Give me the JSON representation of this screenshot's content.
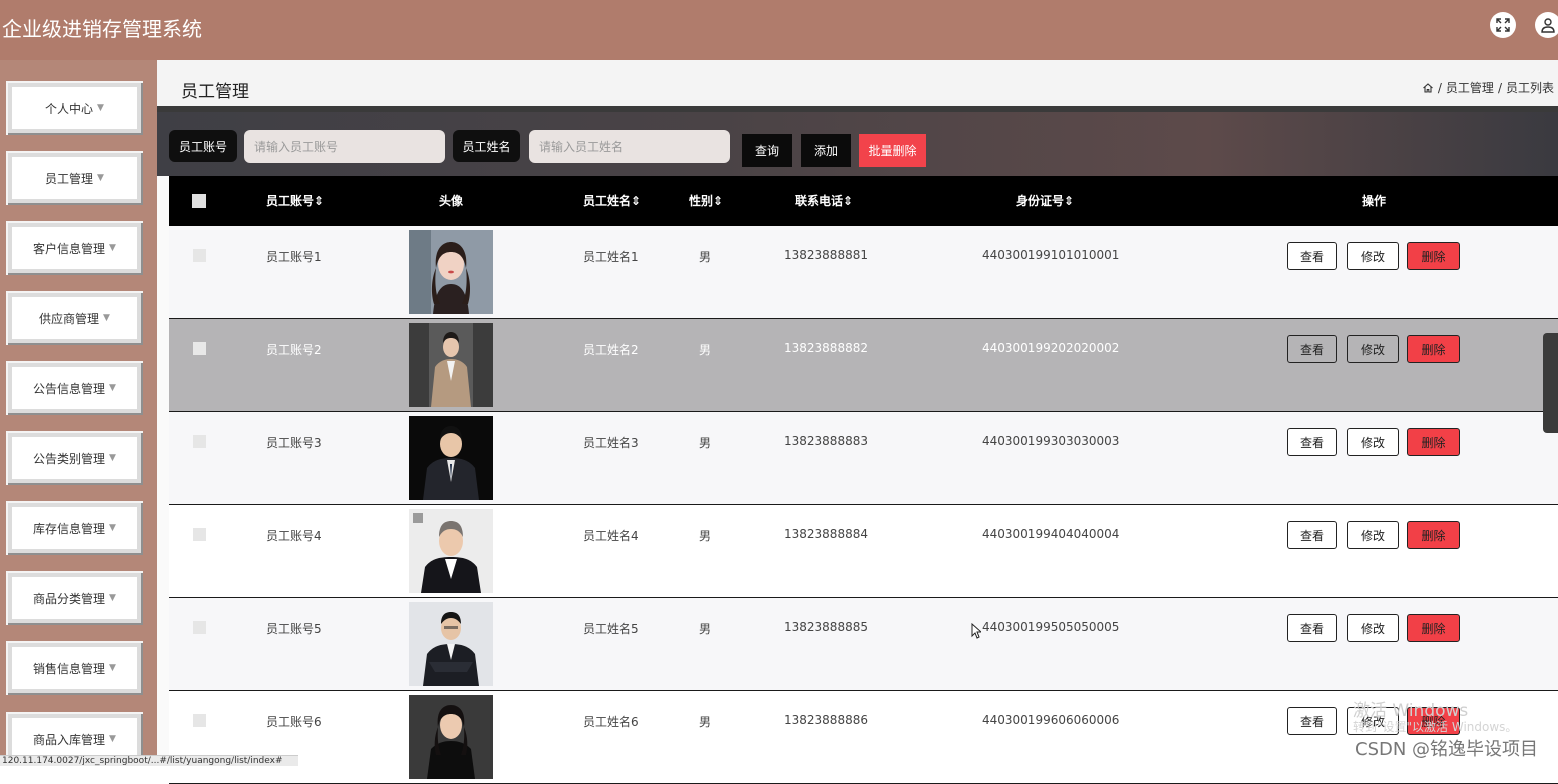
{
  "app": {
    "title": "企业级进销存管理系统",
    "top_icons": [
      "fullscreen-icon",
      "user-icon"
    ]
  },
  "sidebar": {
    "items": [
      {
        "label": "个人中心"
      },
      {
        "label": "员工管理"
      },
      {
        "label": "客户信息管理"
      },
      {
        "label": "供应商管理"
      },
      {
        "label": "公告信息管理"
      },
      {
        "label": "公告类别管理"
      },
      {
        "label": "库存信息管理"
      },
      {
        "label": "商品分类管理"
      },
      {
        "label": "销售信息管理"
      },
      {
        "label": "商品入库管理"
      }
    ]
  },
  "status_url": "120.11.174.0027/jxc_springboot/...#/list/yuangong/list/index#",
  "page": {
    "title": "员工管理",
    "breadcrumb": [
      "员工管理",
      "员工列表"
    ],
    "breadcrumb_sep": "/"
  },
  "search": {
    "account_label": "员工账号",
    "account_placeholder": "请输入员工账号",
    "name_label": "员工姓名",
    "name_placeholder": "请输入员工姓名",
    "query_button": "查询",
    "add_button": "添加",
    "batch_delete_button": "批量删除"
  },
  "table": {
    "headers": {
      "account": "员工账号",
      "avatar": "头像",
      "name": "员工姓名",
      "gender": "性别",
      "phone": "联系电话",
      "id_card": "身份证号",
      "actions": "操作"
    },
    "sort_indicator": "⇕",
    "rows": [
      {
        "account": "员工账号1",
        "name": "员工姓名1",
        "gender": "男",
        "phone": "13823888881",
        "id_card": "440300199101010001"
      },
      {
        "account": "员工账号2",
        "name": "员工姓名2",
        "gender": "男",
        "phone": "13823888882",
        "id_card": "440300199202020002"
      },
      {
        "account": "员工账号3",
        "name": "员工姓名3",
        "gender": "男",
        "phone": "13823888883",
        "id_card": "440300199303030003"
      },
      {
        "account": "员工账号4",
        "name": "员工姓名4",
        "gender": "男",
        "phone": "13823888884",
        "id_card": "440300199404040004"
      },
      {
        "account": "员工账号5",
        "name": "员工姓名5",
        "gender": "男",
        "phone": "13823888885",
        "id_card": "440300199505050005"
      },
      {
        "account": "员工账号6",
        "name": "员工姓名6",
        "gender": "男",
        "phone": "13823888886",
        "id_card": "440300199606060006"
      }
    ],
    "row_actions": {
      "view": "查看",
      "edit": "修改",
      "delete": "删除"
    }
  },
  "overlay": {
    "watermark_line1": "激活 Windows",
    "watermark_line2": "转到\"设置\"以激活 Windows。",
    "csdn": "CSDN @铭逸毕设项目"
  },
  "colors": {
    "topbar": "#b07c6c",
    "sidebar": "#b48778",
    "delete_red": "#f24047",
    "batch_delete": "#f2434b",
    "header_black": "#000000"
  }
}
